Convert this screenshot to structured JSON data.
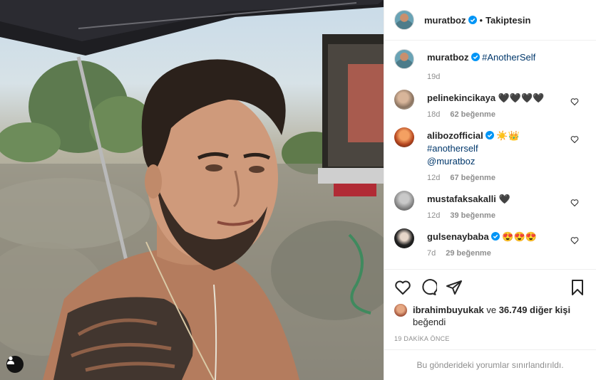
{
  "header": {
    "username": "muratboz",
    "follow_status": "Takiptesin",
    "separator": "•"
  },
  "caption": {
    "username": "muratboz",
    "hashtag": "#AnotherSelf",
    "time": "19d"
  },
  "comments": [
    {
      "username": "pelinekincikaya",
      "text": "🖤🖤🖤🖤",
      "time": "18d",
      "likes": "62 beğenme"
    },
    {
      "username": "alibozofficial",
      "text": "☀️👑",
      "hashtag": "#anotherself",
      "mention": "@muratboz",
      "time": "12d",
      "likes": "67 beğenme"
    },
    {
      "username": "mustafaksakalli",
      "text": "🖤",
      "time": "12d",
      "likes": "39 beğenme"
    },
    {
      "username": "gulsenaybaba",
      "text": "😍😍😍",
      "time": "7d",
      "likes": "29 beğenme"
    }
  ],
  "liked_by": {
    "username": "ibrahimbuyukak",
    "connector": "ve",
    "others": "36.749 diğer kişi",
    "suffix": "beğendi"
  },
  "timestamp": "19 DAKİKA ÖNCE",
  "restricted_notice": "Bu gönderideki yorumlar sınırlandırıldı.",
  "icons": {
    "like": "heart-icon",
    "comment": "comment-bubble-icon",
    "share": "paper-plane-icon",
    "save": "bookmark-icon",
    "tag": "user-tag-icon",
    "verified": "verified-badge-icon"
  },
  "colors": {
    "verified": "#0095f6",
    "hashtag": "#00376b",
    "muted": "#8e8e8e",
    "divider": "#efefef"
  }
}
